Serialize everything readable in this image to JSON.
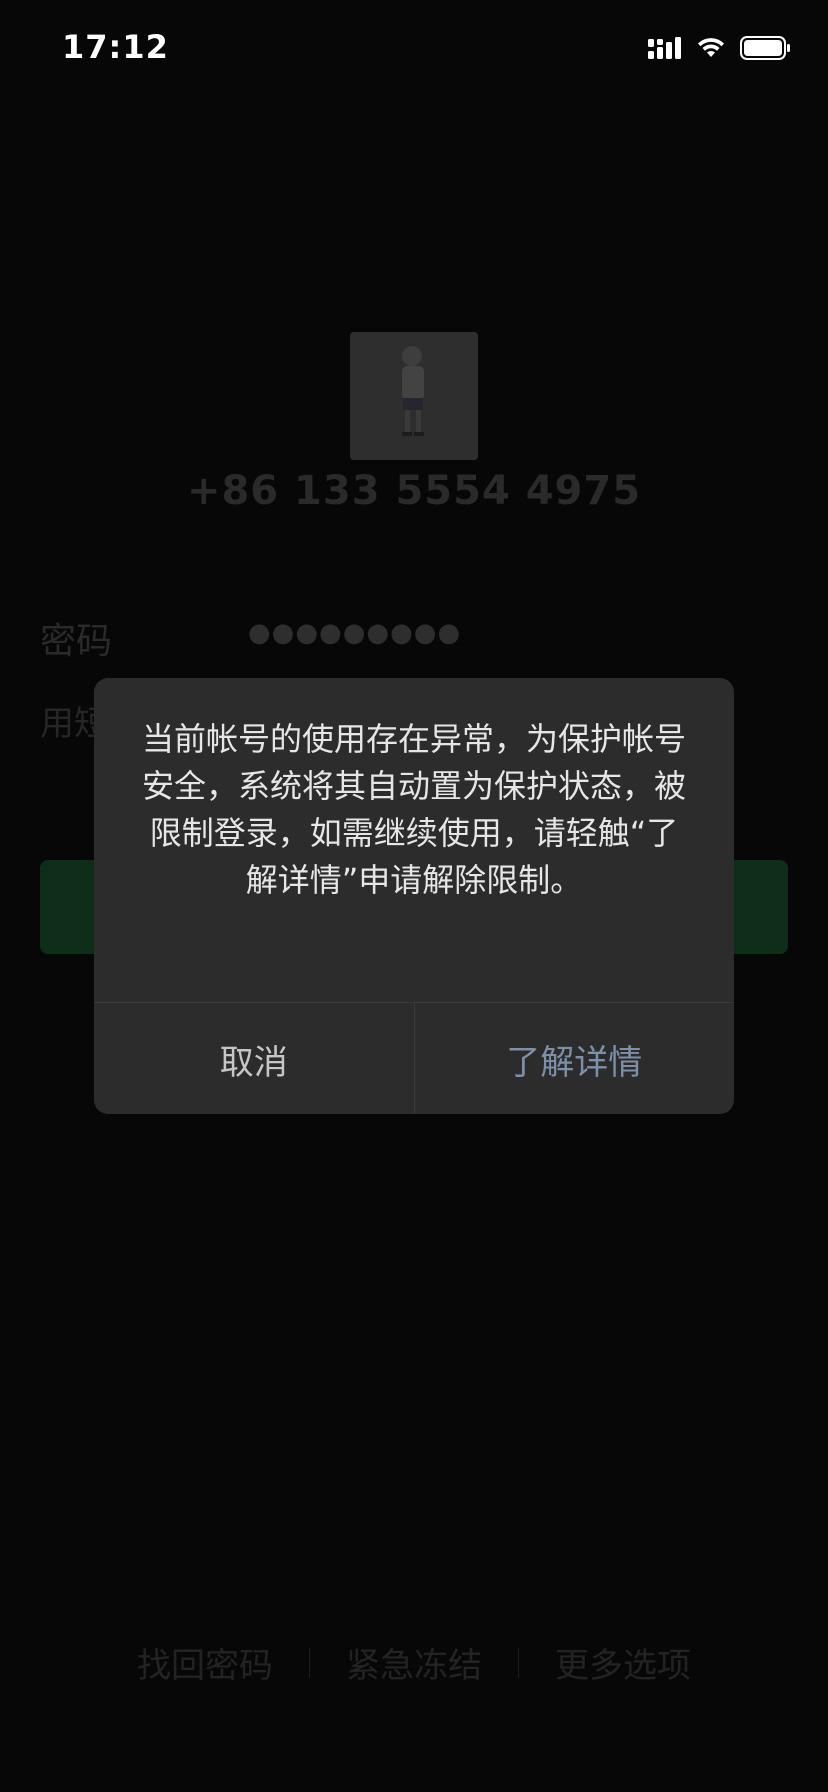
{
  "status_bar": {
    "time": "17:12",
    "icons": [
      "cellular-signal-icon",
      "wifi-icon",
      "battery-icon"
    ]
  },
  "login": {
    "phone_number": "+86 133 5554 4975",
    "password_label": "密码",
    "password_dots": "●●●●●●●●●",
    "sms_login_label": "用短",
    "bottom_links": [
      "找回密码",
      "紧急冻结",
      "更多选项"
    ]
  },
  "dialog": {
    "message": "当前帐号的使用存在异常，为保护帐号安全，系统将其自动置为保护状态，被限制登录，如需继续使用，请轻触“了解详情”申请解除限制。",
    "cancel_label": "取消",
    "details_label": "了解详情"
  },
  "colors": {
    "background": "#070707",
    "dialog_background": "#2c2c2c",
    "details_link": "#7d90aa",
    "login_button": "#0f2e19"
  }
}
